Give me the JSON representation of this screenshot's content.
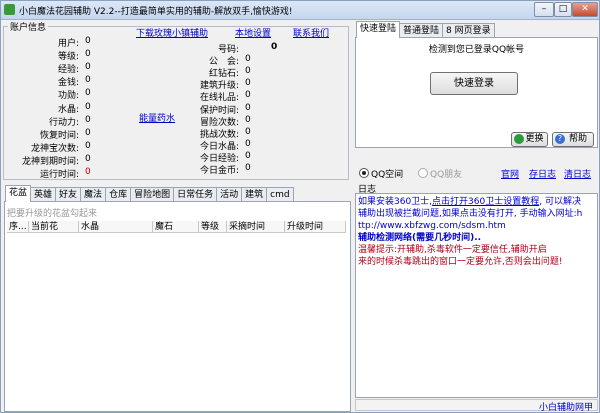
{
  "window": {
    "title": "小白魔法花园辅助 V2.2--打造最简单实用的辅助-解放双手,愉快游戏!"
  },
  "window_controls": {
    "minimize": "–",
    "maximize": "□",
    "close": "✕"
  },
  "account": {
    "legend": "账户信息",
    "left_labels": [
      "用户:",
      "等级:",
      "经验:",
      "金钱:",
      "功勋:",
      "水晶:",
      "行动力:",
      "恢复时间:",
      "龙神宝次数:",
      "龙神到期时间:",
      "运行时间:"
    ],
    "left_values": [
      "0",
      "0",
      "0",
      "0",
      "0",
      "0",
      "0",
      "0",
      "0",
      "0",
      "0"
    ],
    "right_labels": [
      "号码:",
      "公　会:",
      "红钻石:",
      "建筑升级:",
      "在线礼品:",
      "保护时间:",
      "冒险次数:",
      "挑战次数:",
      "今日水晶:",
      "今日经验:",
      "今日金币:"
    ],
    "right_values": [
      "0",
      "0",
      "0",
      "0",
      "0",
      "0",
      "0",
      "0",
      "0",
      "0",
      "0"
    ],
    "links": {
      "download": "下载玫瑰小镇辅助",
      "local_settings": "本地设置",
      "contact": "联系我们",
      "energy_potion": "能量药水"
    }
  },
  "bottom_tabs": [
    "花盆",
    "英雄",
    "好友",
    "魔法",
    "仓库",
    "冒险地图",
    "日常任务",
    "活动",
    "建筑",
    "cmd"
  ],
  "flowerpot": {
    "hint": "把要升级的花盆勾起来",
    "columns": [
      "序...",
      "当前花",
      "水晶",
      "魔石",
      "等级",
      "采摘时间",
      "升级时间"
    ]
  },
  "login": {
    "tabs": [
      "快速登陆",
      "普通登陆",
      "8 网页登录"
    ],
    "status": "检测到您已登录QQ帐号",
    "quick_login_button": "快速登录",
    "switch_button": "更换",
    "help_button": "帮助",
    "radio_qqspace": "QQ空间",
    "radio_qqfriend": "QQ朋友",
    "links": [
      "官网",
      "存日志",
      "清日志"
    ]
  },
  "log": {
    "legend": "日志",
    "lines": [
      {
        "text": "如果安装360卫士,",
        "color": "#0000cc"
      },
      {
        "text": "辅助出现被拦截问题,如果点击没有打开, 手动输入网址:h",
        "color": "#0000cc"
      },
      {
        "text": "ttp://www.xbfzwg.com/sdsm.htm",
        "color": "#0000cc"
      },
      {
        "text": "辅助检测网络(需要几秒时间)..",
        "color": "#0000cc"
      },
      {
        "text": "温馨提示:开辅助,杀毒软件一定要信任,辅助开启",
        "color": "#b0001a"
      },
      {
        "text": "来的时候杀毒跳出的窗口一定要允许,否则会出问题!",
        "color": "#b0001a"
      }
    ],
    "link_text": "点击打开360卫士设置教程",
    "link_tail": ", 可以解决"
  },
  "statusbar": {
    "text": "小白辅助网甲"
  }
}
